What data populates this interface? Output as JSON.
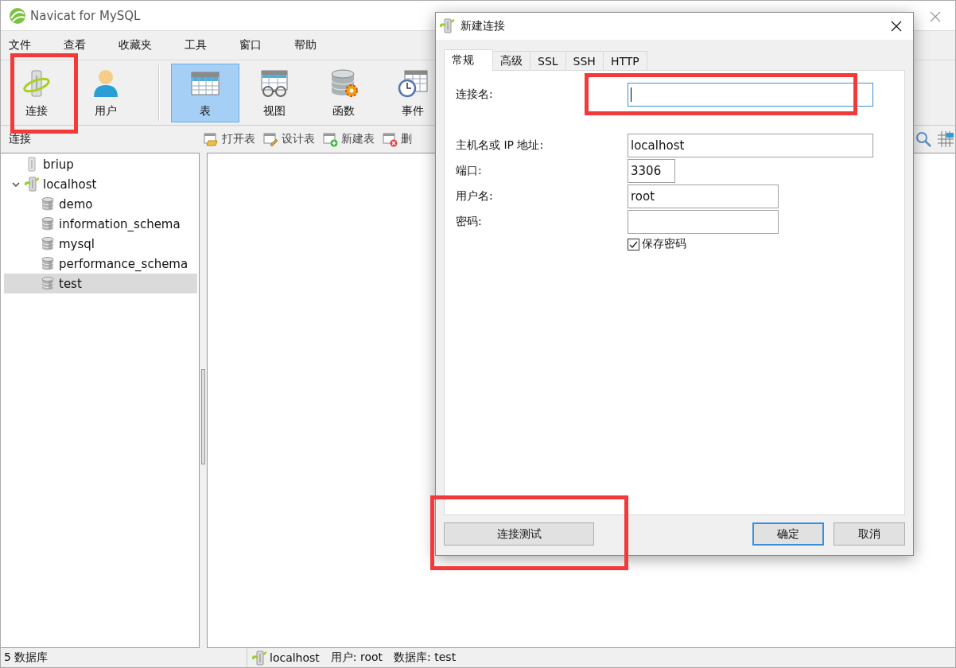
{
  "window": {
    "title": "Navicat for MySQL"
  },
  "menu": [
    "文件",
    "查看",
    "收藏夹",
    "工具",
    "窗口",
    "帮助"
  ],
  "toolbar": [
    {
      "label": "连接",
      "kind": "connect",
      "selected": false
    },
    {
      "label": "用户",
      "kind": "user",
      "selected": false
    },
    {
      "label": "表",
      "kind": "table",
      "selected": true
    },
    {
      "label": "视图",
      "kind": "view",
      "selected": false
    },
    {
      "label": "函数",
      "kind": "function",
      "selected": false
    },
    {
      "label": "事件",
      "kind": "event",
      "selected": false
    }
  ],
  "object_bar": {
    "title": "连接",
    "actions": [
      {
        "label": "打开表",
        "kind": "open"
      },
      {
        "label": "设计表",
        "kind": "design"
      },
      {
        "label": "新建表",
        "kind": "new"
      },
      {
        "label": "删",
        "kind": "delete"
      }
    ]
  },
  "tree": [
    {
      "label": "briup",
      "kind": "server",
      "selected": false
    },
    {
      "label": "localhost",
      "kind": "server-connected",
      "selected": false,
      "expanded": true,
      "children": [
        {
          "label": "demo",
          "kind": "database",
          "selected": false
        },
        {
          "label": "information_schema",
          "kind": "database",
          "selected": false
        },
        {
          "label": "mysql",
          "kind": "database",
          "selected": false
        },
        {
          "label": "performance_schema",
          "kind": "database",
          "selected": false
        },
        {
          "label": "test",
          "kind": "database",
          "selected": true
        }
      ]
    }
  ],
  "status_bar": {
    "count": "5 数据库",
    "connection": "localhost",
    "user": "用户: root",
    "database": "数据库: test"
  },
  "dialog": {
    "title": "新建连接",
    "tabs": [
      {
        "label": "常规",
        "selected": true
      },
      {
        "label": "高级",
        "selected": false
      },
      {
        "label": "SSL",
        "selected": false
      },
      {
        "label": "SSH",
        "selected": false
      },
      {
        "label": "HTTP",
        "selected": false
      }
    ],
    "fields": [
      {
        "label": "连接名:",
        "kind": "long",
        "focused": true
      },
      {
        "label": "主机名或 IP 地址:",
        "kind": "long",
        "value": "localhost",
        "focused": false
      },
      {
        "label": "端口:",
        "kind": "short",
        "value": "3306",
        "focused": false
      },
      {
        "label": "用户名:",
        "kind": "medium",
        "value": "root",
        "focused": false
      },
      {
        "label": "密码:",
        "kind": "medium",
        "focused": false
      }
    ],
    "save_password": {
      "label": "保存密码",
      "checked": true
    },
    "buttons": [
      {
        "label": "连接测试",
        "kind": "test"
      },
      {
        "label": "确定",
        "kind": "default"
      },
      {
        "label": "取消",
        "kind": "normal"
      }
    ]
  }
}
